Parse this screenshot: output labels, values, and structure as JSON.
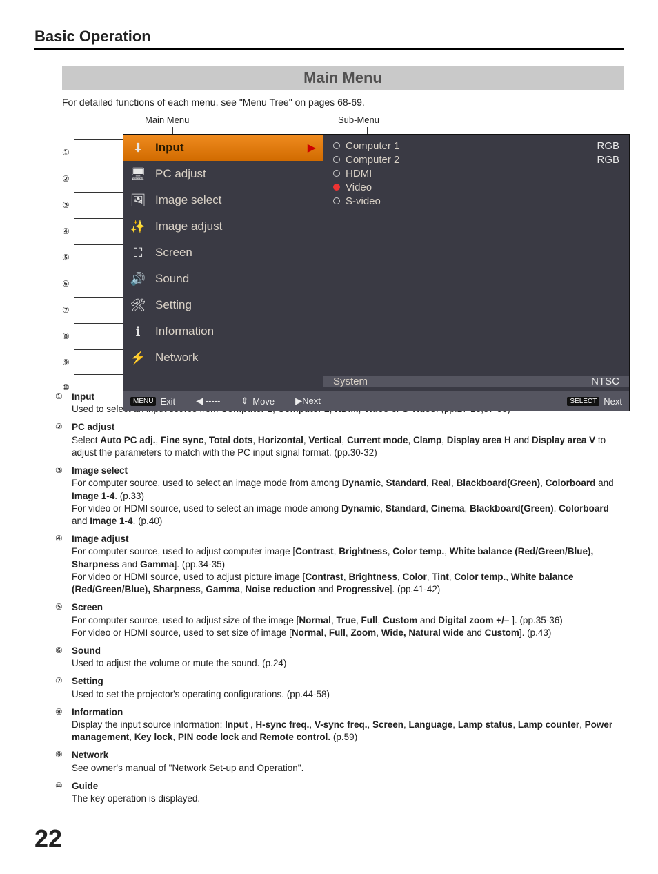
{
  "heading": "Basic Operation",
  "menu_bar_title": "Main Menu",
  "subnote": "For detailed functions of each menu, see \"Menu Tree\" on pages 68-69.",
  "col_label_main": "Main Menu",
  "col_label_sub": "Sub-Menu",
  "page_number": "22",
  "menu_items": [
    {
      "n": "①",
      "label": "Input",
      "selected": true
    },
    {
      "n": "②",
      "label": "PC adjust",
      "selected": false
    },
    {
      "n": "③",
      "label": "Image select",
      "selected": false
    },
    {
      "n": "④",
      "label": "Image adjust",
      "selected": false
    },
    {
      "n": "⑤",
      "label": "Screen",
      "selected": false
    },
    {
      "n": "⑥",
      "label": "Sound",
      "selected": false
    },
    {
      "n": "⑦",
      "label": "Setting",
      "selected": false
    },
    {
      "n": "⑧",
      "label": "Information",
      "selected": false
    },
    {
      "n": "⑨",
      "label": "Network",
      "selected": false
    }
  ],
  "sub_items": [
    {
      "label": "Computer 1",
      "right": "RGB",
      "sel": false
    },
    {
      "label": "Computer 2",
      "right": "RGB",
      "sel": false
    },
    {
      "label": "HDMI",
      "right": "",
      "sel": false
    },
    {
      "label": "Video",
      "right": "",
      "sel": true
    },
    {
      "label": "S-video",
      "right": "",
      "sel": false
    }
  ],
  "system_row": {
    "label": "System",
    "value": "NTSC"
  },
  "guide_n": "⑩",
  "guide": {
    "exit_key": "MENU",
    "exit": "Exit",
    "back": "◀ -----",
    "move": "Move",
    "next1": "▶Next",
    "next2_key": "SELECT",
    "next2": "Next"
  },
  "descriptions": [
    {
      "n": "①",
      "title": "Input",
      "html": "Used to select an input source from <b>Computer 1</b>, <b>Computer 2</b>, <b>HDMI</b>, <b>Video</b> or <b>S-video</b>.  (pp.27-28,37-38)"
    },
    {
      "n": "②",
      "title": "PC adjust",
      "html": "Select <b>Auto PC adj.</b>, <b>Fine sync</b>, <b>Total dots</b>, <b>Horizontal</b>, <b>Vertical</b>, <b>Current mode</b>, <b>Clamp</b>, <b>Display area H</b> and <b>Display area V</b> to adjust the parameters to match with the PC input signal format.  (pp.30-32)"
    },
    {
      "n": "③",
      "title": "Image select",
      "html": "For computer source, used to select an image mode from among <b>Dynamic</b>, <b>Standard</b>, <b>Real</b>, <b>Blackboard(Green)</b>, <b>Colorboard</b> and <b>Image 1-4</b>.  (p.33)<br>For video or HDMI source, used to select an image mode among <b>Dynamic</b>, <b>Standard</b>, <b>Cinema</b>, <b>Blackboard(Green)</b>, <b>Colorboard</b> and <b>Image 1-4</b>.  (p.40)"
    },
    {
      "n": "④",
      "title": "Image adjust",
      "html": "For computer source, used to adjust computer image [<b>Contrast</b>, <b>Brightness</b>, <b>Color temp.</b>, <b>White balance (Red/Green/Blue), Sharpness</b> and <b>Gamma</b>].  (pp.34-35)<br>For video or HDMI source, used to adjust picture image [<b>Contrast</b>, <b>Brightness</b>, <b>Color</b>, <b>Tint</b>, <b>Color temp.</b>, <b>White balance (Red/Green/Blue), Sharpness</b>, <b>Gamma</b>, <b>Noise reduction</b> and <b>Progressive</b>].  (pp.41-42)"
    },
    {
      "n": "⑤",
      "title": "Screen",
      "html": "For computer source, used to adjust size of the image [<b>Normal</b>, <b>True</b>, <b>Full</b>, <b>Custom</b> and <b>Digital zoom +/–</b> ].  (pp.35-36)<br>For video or HDMI source, used to set size  of image [<b>Normal</b>, <b>Full</b>, <b>Zoom</b>, <b>Wide, Natural wide</b> and <b>Custom</b>].  (p.43)"
    },
    {
      "n": "⑥",
      "title": "Sound",
      "html": "Used to adjust the volume or mute the sound.  (p.24)"
    },
    {
      "n": "⑦",
      "title": "Setting",
      "html": "Used to set the projector's operating configurations.  (pp.44-58)"
    },
    {
      "n": "⑧",
      "title": "Information",
      "html": "Display the input source information: <b>Input</b> , <b>H-sync freq.</b>, <b>V-sync freq.</b>, <b>Screen</b>, <b>Language</b>, <b>Lamp status</b>, <b>Lamp counter</b>, <b>Power management</b>, <b>Key lock</b>, <b>PIN code lock</b> and <b>Remote control.</b>  (p.59)"
    },
    {
      "n": "⑨",
      "title": "Network",
      "html": "See owner's manual of \"Network Set-up and Operation\"."
    },
    {
      "n": "⑩",
      "title": "Guide",
      "html": "The key operation is displayed."
    }
  ],
  "icons": {
    "input": "⬇",
    "pc": "🖥",
    "imgsel": "🖼",
    "imgadj": "✨",
    "screen": "⛶",
    "sound": "🔊",
    "setting": "🛠",
    "info": "ℹ",
    "network": "⚡"
  }
}
